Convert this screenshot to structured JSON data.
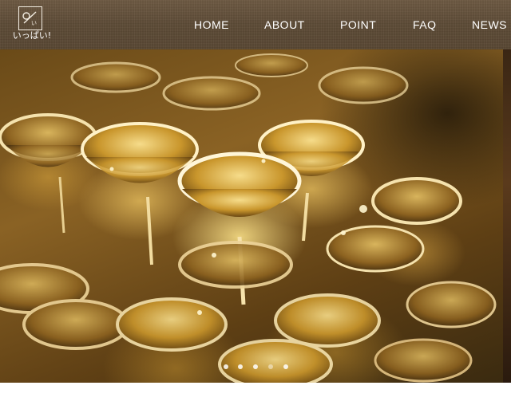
{
  "header": {
    "logo_text": "いっぱい!",
    "nav": [
      {
        "label": "HOME"
      },
      {
        "label": "ABOUT"
      },
      {
        "label": "POINT"
      },
      {
        "label": "FAQ"
      },
      {
        "label": "NEWS"
      }
    ]
  },
  "hero": {
    "image": "champagne-glass-tower",
    "slide_count": 5,
    "active_slide": 5
  },
  "colors": {
    "header_bg": "#5e4c37",
    "nav_text": "#ffffff",
    "dot_active": "#ffffff"
  }
}
